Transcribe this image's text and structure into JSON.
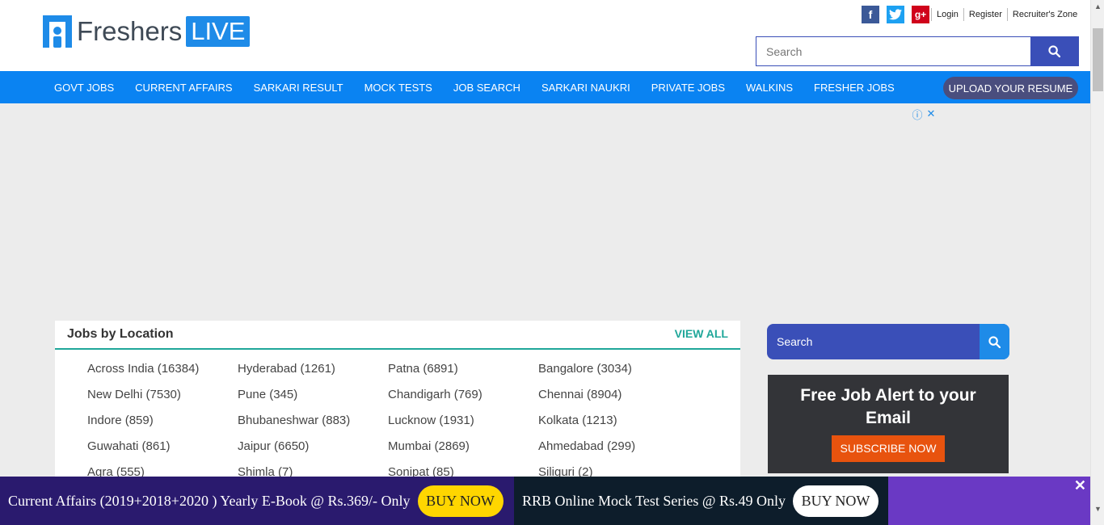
{
  "header": {
    "logo_word": "Freshers",
    "logo_badge": "LIVE",
    "social": [
      "f",
      "t",
      "g+"
    ],
    "social_icons": [
      "facebook-icon",
      "twitter-icon",
      "google-plus-icon"
    ],
    "toplinks": [
      "Login",
      "Register",
      "Recruiter's Zone"
    ],
    "search_placeholder": "Search"
  },
  "nav": {
    "items": [
      "GOVT JOBS",
      "CURRENT AFFAIRS",
      "SARKARI RESULT",
      "MOCK TESTS",
      "JOB SEARCH",
      "SARKARI NAUKRI",
      "PRIVATE JOBS",
      "WALKINS",
      "FRESHER JOBS"
    ],
    "upload_label": "UPLOAD YOUR RESUME"
  },
  "ad": {
    "info_icon": "ⓘ",
    "close_icon": "✕"
  },
  "jobs": {
    "title": "Jobs by Location",
    "view_all": "VIEW ALL",
    "locations": [
      "Across India (16384)",
      "Hyderabad (1261)",
      "Patna (6891)",
      "Bangalore (3034)",
      "New Delhi (7530)",
      "Pune (345)",
      "Chandigarh (769)",
      "Chennai (8904)",
      "Indore (859)",
      "Bhubaneshwar (883)",
      "Lucknow (1931)",
      "Kolkata (1213)",
      "Guwahati (861)",
      "Jaipur (6650)",
      "Mumbai (2869)",
      "Ahmedabad (299)",
      "Agra (555)",
      "Shimla (7)",
      "Sonipat (85)",
      "Siliguri (2)"
    ]
  },
  "sidebar": {
    "search_placeholder": "Search",
    "alert_title": "Free Job Alert to your Email",
    "subscribe_label": "SUBSCRIBE NOW"
  },
  "banner": {
    "text1": "Current Affairs (2019+2018+2020 ) Yearly E-Book @ Rs.369/- Only",
    "buy1": "BUY NOW",
    "text2": "RRB Online Mock Test Series @ Rs.49 Only",
    "buy2": "BUY NOW",
    "close": "✕"
  },
  "colors": {
    "nav_blue": "#0a83f2",
    "search_blue": "#3a4fb8",
    "teal": "#20a79a",
    "orange": "#e8530e"
  }
}
